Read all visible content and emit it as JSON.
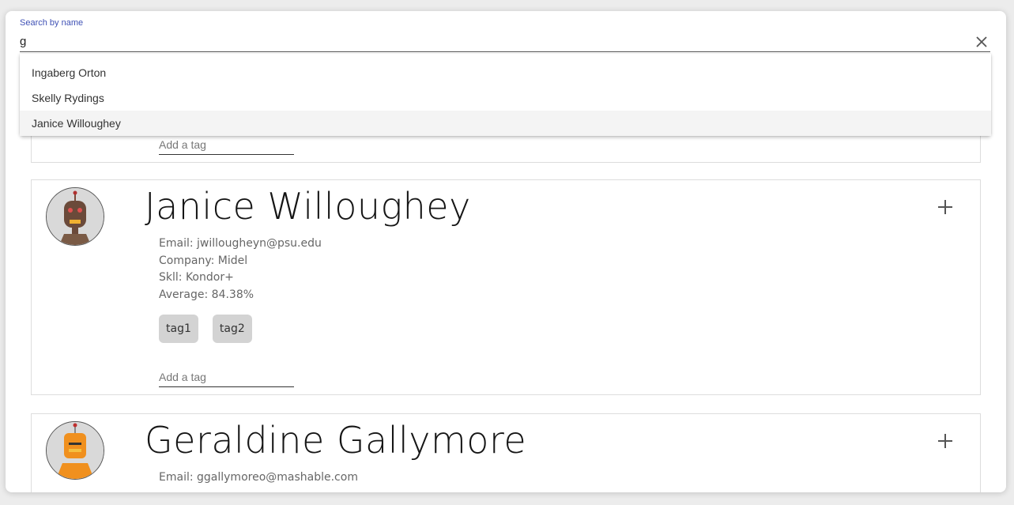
{
  "search": {
    "label": "Search by name",
    "value": "g",
    "options": [
      "Ingaberg Orton",
      "Skelly Rydings",
      "Janice Willoughey"
    ],
    "active_option": 2
  },
  "cards": [
    {
      "tag_placeholder": "Add a tag"
    },
    {
      "name": "Janice Willoughey",
      "email": "Email: jwillougheyn@psu.edu",
      "company": "Company: Midel",
      "skill": "Skll: Kondor+",
      "average": "Average: 84.38%",
      "tags": [
        "tag1",
        "tag2"
      ],
      "tag_placeholder": "Add a tag",
      "avatar_icon": "robot-avatar-brown"
    },
    {
      "name": "Geraldine Gallymore",
      "email": "Email: ggallymoreo@mashable.com",
      "avatar_icon": "robot-avatar-orange"
    }
  ],
  "colors": {
    "accent": "#3f51b5",
    "tag_bg": "#d3d3d3"
  }
}
